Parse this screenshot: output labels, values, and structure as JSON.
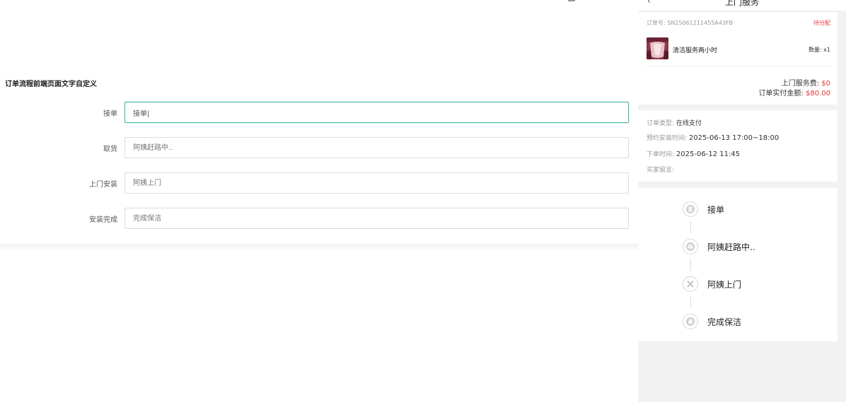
{
  "settings": {
    "section_title": "订单流程前端页面文字自定义",
    "fields": [
      {
        "label": "接单",
        "value": "接单|"
      },
      {
        "label": "取货",
        "placeholder": "阿姨赶路中.."
      },
      {
        "label": "上门安装",
        "placeholder": "阿姨上门"
      },
      {
        "label": "安装完成",
        "placeholder": "完成保洁"
      }
    ]
  },
  "preview": {
    "nav": {
      "back_icon": "chevron-left-icon",
      "title": "上门服务"
    },
    "order": {
      "order_no": "订单号: SN25061211455A43FB",
      "status": "待分配",
      "status_color": "#e4393c",
      "product_name": "清洁服务两小时",
      "quantity": "数量: x1",
      "service_fee_label": "上门服务费:",
      "service_fee": "$0",
      "paid_label": "订单实付金额:",
      "paid_amount": "$80.00"
    },
    "info": {
      "type_label": "订单类型:",
      "type_value": "在线支付",
      "booking_label": "预约安装时间:",
      "booking_value": "2025-06-13 17:00~18:00",
      "created_label": "下单时间:",
      "created_value": "2025-06-12 11:45",
      "message_label": "买家留言:"
    },
    "steps": [
      {
        "label": "接单",
        "icon": "clipboard-icon"
      },
      {
        "label": "阿姨赶路中..",
        "icon": "box-icon"
      },
      {
        "label": "阿姨上门",
        "icon": "tools-icon"
      },
      {
        "label": "完成保洁",
        "icon": "bag-icon"
      }
    ]
  },
  "colors": {
    "accent": "#3fb8a4",
    "price": "#e4393c"
  }
}
